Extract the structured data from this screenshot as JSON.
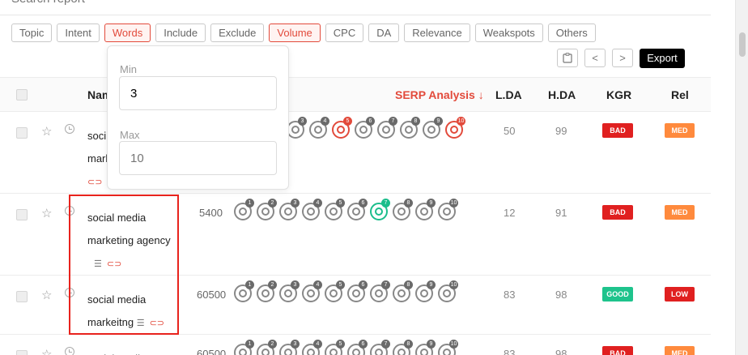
{
  "search": {
    "placeholder": "Search report"
  },
  "filters": [
    {
      "label": "Topic",
      "active": false
    },
    {
      "label": "Intent",
      "active": false
    },
    {
      "label": "Words",
      "active": true
    },
    {
      "label": "Include",
      "active": false
    },
    {
      "label": "Exclude",
      "active": false
    },
    {
      "label": "Volume",
      "active": true
    },
    {
      "label": "CPC",
      "active": false
    },
    {
      "label": "DA",
      "active": false
    },
    {
      "label": "Relevance",
      "active": false
    },
    {
      "label": "Weakspots",
      "active": false
    },
    {
      "label": "Others",
      "active": false
    }
  ],
  "toolbar": {
    "export_label": "Export",
    "prev_icon": "<",
    "next_icon": ">"
  },
  "popup": {
    "min_label": "Min",
    "min_value": "3",
    "max_label": "Max",
    "max_placeholder": "10"
  },
  "table": {
    "headers": {
      "name": "Nam",
      "serp": "SERP Analysis ↓",
      "lda": "L.DA",
      "hda": "H.DA",
      "kgr": "KGR",
      "rel": "Rel"
    },
    "rows": [
      {
        "kw1": "soci",
        "kw2": "mark",
        "volume": "",
        "lda": "50",
        "hda": "99",
        "kgr": "BAD",
        "rel": "MED"
      },
      {
        "kw1": "social media",
        "kw2": "marketing agency",
        "volume": "5400",
        "lda": "12",
        "hda": "91",
        "kgr": "BAD",
        "rel": "MED"
      },
      {
        "kw1": "social media",
        "kw2": "markeitng",
        "volume": "60500",
        "lda": "83",
        "hda": "98",
        "kgr": "GOOD",
        "rel": "LOW"
      },
      {
        "kw1": "social media",
        "kw2": "",
        "volume": "60500",
        "lda": "83",
        "hda": "98",
        "kgr": "BAD",
        "rel": "MED"
      }
    ]
  },
  "serp_circles": {
    "row1": [
      "3",
      "4",
      "5",
      "6",
      "7",
      "8",
      "9",
      "10"
    ],
    "row2": [
      "1",
      "2",
      "3",
      "4",
      "5",
      "6",
      "7",
      "8",
      "9",
      "10"
    ],
    "row3": [
      "1",
      "2",
      "3",
      "4",
      "5",
      "6",
      "7",
      "8",
      "9",
      "10"
    ],
    "row4": [
      "1",
      "2",
      "3",
      "4",
      "5",
      "6",
      "7",
      "8",
      "9",
      "10"
    ]
  },
  "colors": {
    "accent": "#e24a3b",
    "good": "#1ec38c",
    "bad": "#e02020",
    "med": "#ff8a3d",
    "highlight": "#e8231d"
  }
}
